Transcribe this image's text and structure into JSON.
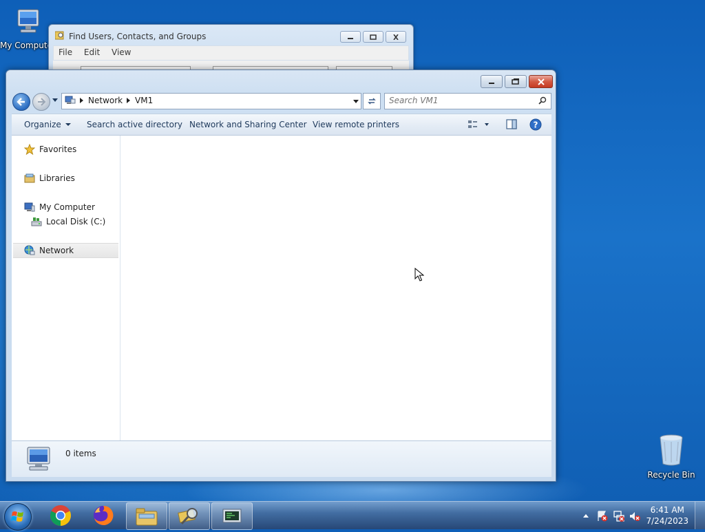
{
  "desktop": {
    "icons": [
      {
        "label": "My Computer",
        "icon": "computer-icon"
      },
      {
        "label": "Recycle Bin",
        "icon": "recycle-bin-icon"
      }
    ]
  },
  "find_window": {
    "title": "Find Users, Contacts, and Groups",
    "menu": [
      "File",
      "Edit",
      "View"
    ]
  },
  "explorer": {
    "breadcrumb": [
      "Network",
      "VM1"
    ],
    "search_placeholder": "Search VM1",
    "toolbar": {
      "organize": "Organize",
      "search_ad": "Search active directory",
      "network_sharing": "Network and Sharing Center",
      "remote_printers": "View remote printers"
    },
    "nav": [
      {
        "label": "Favorites",
        "icon": "star-icon"
      },
      {
        "label": "Libraries",
        "icon": "libraries-icon"
      },
      {
        "label": "My Computer",
        "icon": "computer-icon"
      },
      {
        "label": "Local Disk (C:)",
        "icon": "disk-icon"
      },
      {
        "label": "Network",
        "icon": "network-icon",
        "selected": true
      }
    ],
    "details": {
      "item_count": "0 items"
    }
  },
  "taskbar": {
    "pinned": [
      "start-orb",
      "chrome-icon",
      "firefox-icon",
      "file-explorer-icon",
      "search-users-icon",
      "terminal-icon"
    ],
    "clock": {
      "time": "6:41 AM",
      "date": "7/24/2023"
    }
  },
  "colors": {
    "accent": "#1a72c9",
    "close": "#c53a22",
    "toolbar_text": "#1e395b"
  }
}
